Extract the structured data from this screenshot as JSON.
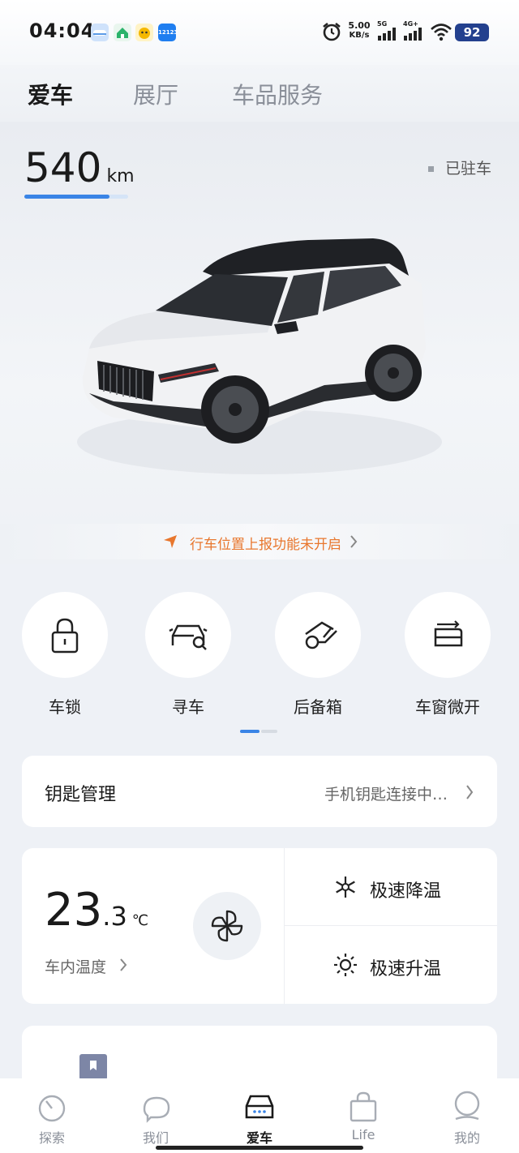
{
  "status_bar": {
    "time": "04:04",
    "net_speed_value": "5.00",
    "net_speed_unit": "KB/s",
    "signal_1": "5G",
    "signal_2": "4G+",
    "battery": "92",
    "app_icons": [
      "cloud-app-icon",
      "home-app-icon",
      "yellow-app-icon",
      "12123-app-icon"
    ],
    "app_icon_text_4": "12123"
  },
  "top_tabs": [
    "爱车",
    "展厅",
    "车品服务"
  ],
  "hero": {
    "range_value": "540",
    "range_unit": "km",
    "range_level": 0.82,
    "parked_status": "已驻车",
    "location_notice": "行车位置上报功能未开启"
  },
  "quick_actions": [
    {
      "label": "车锁",
      "icon": "lock-icon"
    },
    {
      "label": "寻车",
      "icon": "find-car-icon"
    },
    {
      "label": "后备箱",
      "icon": "trunk-icon"
    },
    {
      "label": "车窗微开",
      "icon": "window-icon"
    }
  ],
  "pager": {
    "pages": 2,
    "current": 1
  },
  "key_management": {
    "title": "钥匙管理",
    "status": "手机钥匙连接中…"
  },
  "climate": {
    "temp_int": "23",
    "temp_dec": ".3",
    "temp_unit": "℃",
    "temp_label": "车内温度",
    "cool_label": "极速降温",
    "heat_label": "极速升温"
  },
  "bottom_nav": [
    {
      "label": "探索",
      "icon": "explore-icon"
    },
    {
      "label": "我们",
      "icon": "chat-icon"
    },
    {
      "label": "爱车",
      "icon": "car-icon",
      "active": true
    },
    {
      "label": "Life",
      "icon": "shopping-bag-icon"
    },
    {
      "label": "我的",
      "icon": "profile-icon"
    }
  ],
  "colors": {
    "accent_blue": "#3a84e6",
    "notice_orange": "#e8772e",
    "background": "#eef1f6"
  }
}
